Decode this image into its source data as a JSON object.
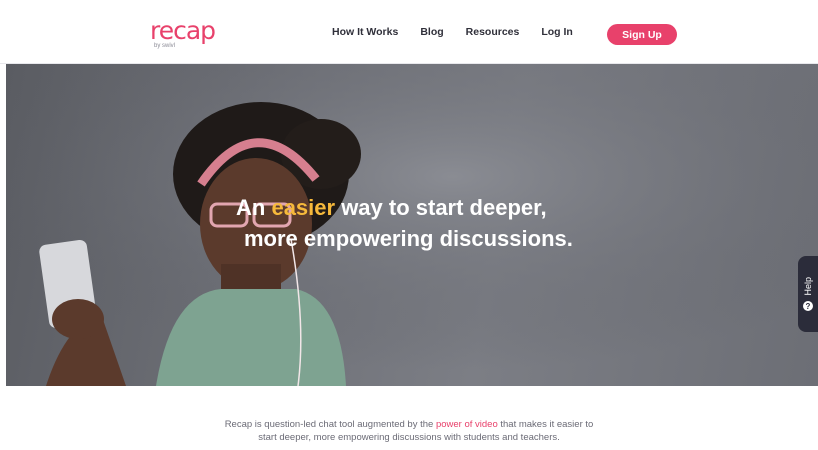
{
  "header": {
    "logo_text": "recap",
    "logo_sub": "by swivl",
    "nav": [
      "How It Works",
      "Blog",
      "Resources",
      "Log In"
    ],
    "signup_label": "Sign Up"
  },
  "hero": {
    "headline_pre": "An ",
    "headline_accent": "easier",
    "headline_post": " way to start deeper,",
    "headline_line2": "more empowering discussions.",
    "help_label": "Help",
    "help_icon": "?"
  },
  "intro": {
    "text_pre": "Recap is question-led chat tool augmented by the ",
    "link_text": "power of video",
    "text_post": " that makes it easier to",
    "line2": "start deeper, more empowering discussions with students and teachers."
  },
  "colors": {
    "brand": "#e8416b",
    "accent": "#f6b93b",
    "help_tab": "#2b2c3a"
  }
}
